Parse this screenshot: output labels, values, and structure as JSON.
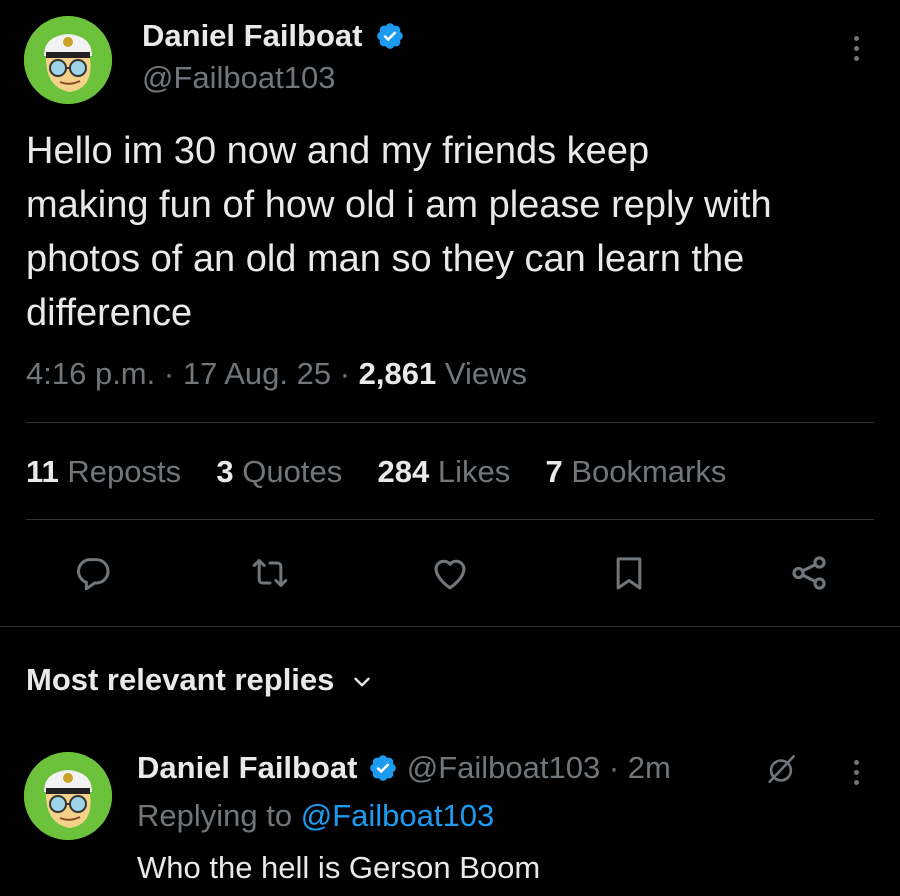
{
  "tweet": {
    "author_name": "Daniel Failboat",
    "author_handle": "@Failboat103",
    "text_lines": [
      "Hello im 30 now and my friends keep",
      "making fun of how old i am please reply with",
      "photos of an old man so they can learn the",
      "difference"
    ],
    "time": "4:16 p.m.",
    "date": "17 Aug. 25",
    "separator": "·",
    "views_count": "2,861",
    "views_label": "Views"
  },
  "stats": {
    "reposts_count": "11",
    "reposts_label": "Reposts",
    "quotes_count": "3",
    "quotes_label": "Quotes",
    "likes_count": "284",
    "likes_label": "Likes",
    "bookmarks_count": "7",
    "bookmarks_label": "Bookmarks"
  },
  "replies_header": {
    "label": "Most relevant replies"
  },
  "reply": {
    "author_name": "Daniel Failboat",
    "author_handle": "@Failboat103",
    "separator": "·",
    "time_ago": "2m",
    "replying_to_label": "Replying to",
    "replying_to_handle": "@Failboat103",
    "text": "Who the hell is Gerson Boom"
  },
  "colors": {
    "background": "#000000",
    "text": "#e7e9ea",
    "muted": "#71767b",
    "accent": "#1d9bf0",
    "divider": "#2f3336"
  },
  "icons": [
    "verified-badge-icon",
    "more-icon",
    "reply-icon",
    "repost-icon",
    "like-icon",
    "bookmark-icon",
    "share-icon",
    "chevron-down-icon",
    "grok-icon"
  ]
}
